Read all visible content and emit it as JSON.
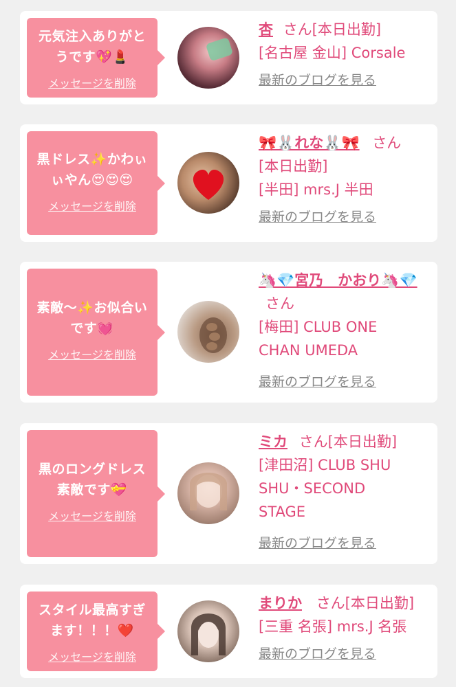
{
  "colors": {
    "accent": "#e04a7a",
    "bubble": "#f7909f",
    "page_bg": "#f0f0f0",
    "card_bg": "#ffffff",
    "link_gray": "#888888"
  },
  "delete_label": "メッセージを削除",
  "blog_label": "最新のブログを見る",
  "cards": [
    {
      "message": "元気注入ありがとうです💖💄",
      "name": "杏",
      "san": "さん[本日出勤]",
      "shop_lines": [
        "[名古屋 金山] Corsale"
      ],
      "avatar": "avatar-photo-1"
    },
    {
      "message": "黒ドレス✨かわぃぃやん😍😍😍",
      "name": "🎀🐰れな🐰🎀",
      "san": "さん",
      "shop_lines": [
        "[本日出勤]",
        "[半田] mrs.J 半田"
      ],
      "avatar": "avatar-photo-2"
    },
    {
      "message": "素敵〜✨お似合いです💓",
      "name": "🦄💎宮乃　かおり🦄💎",
      "san": "さん",
      "shop_lines": [
        "[梅田] CLUB ONE",
        "CHAN UMEDA"
      ],
      "avatar": "avatar-photo-3"
    },
    {
      "message": "黒のロングドレス素敵です💝",
      "name": "ミカ",
      "san": "さん[本日出勤]",
      "shop_lines": [
        "[津田沼] CLUB SHU",
        "SHU・SECOND",
        "STAGE"
      ],
      "avatar": "avatar-photo-4"
    },
    {
      "message": "スタイル最高すぎます！！！❤️",
      "name": "まりか",
      "san": "さん[本日出勤]",
      "shop_lines": [
        "[三重 名張] mrs.J 名張"
      ],
      "avatar": "avatar-photo-5"
    }
  ]
}
